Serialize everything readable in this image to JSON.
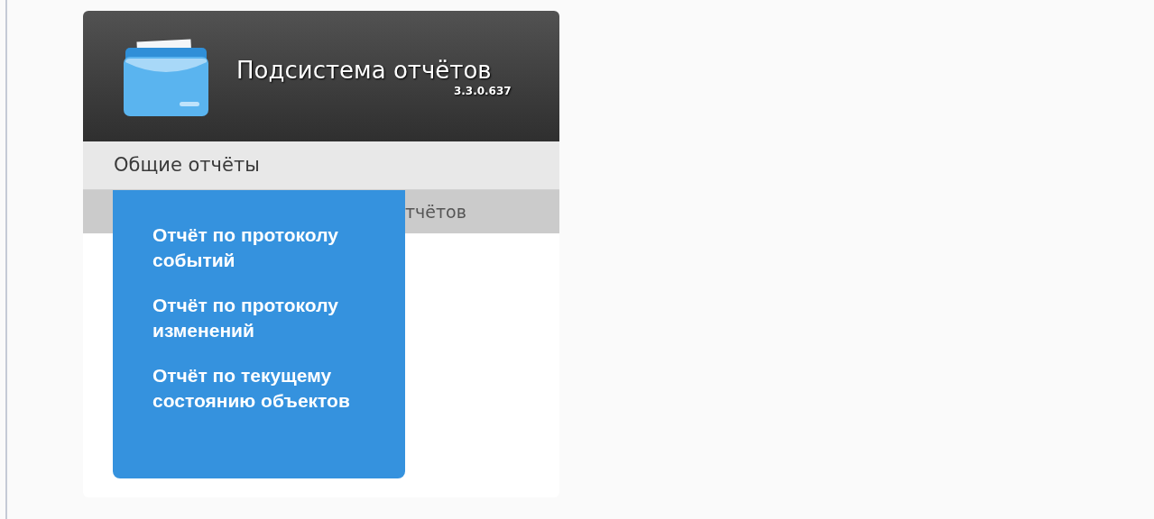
{
  "header": {
    "title": "Подсистема отчётов",
    "version": "3.3.0.637"
  },
  "menu": {
    "label": "Общие отчёты",
    "expanded": true
  },
  "submenu": {
    "label": "тчётов"
  },
  "dropdown": [
    {
      "label": "Отчёт по протоколу событий"
    },
    {
      "label": "Отчёт по протоколу изменений"
    },
    {
      "label": "Отчёт по текущему состоянию объектов"
    }
  ]
}
